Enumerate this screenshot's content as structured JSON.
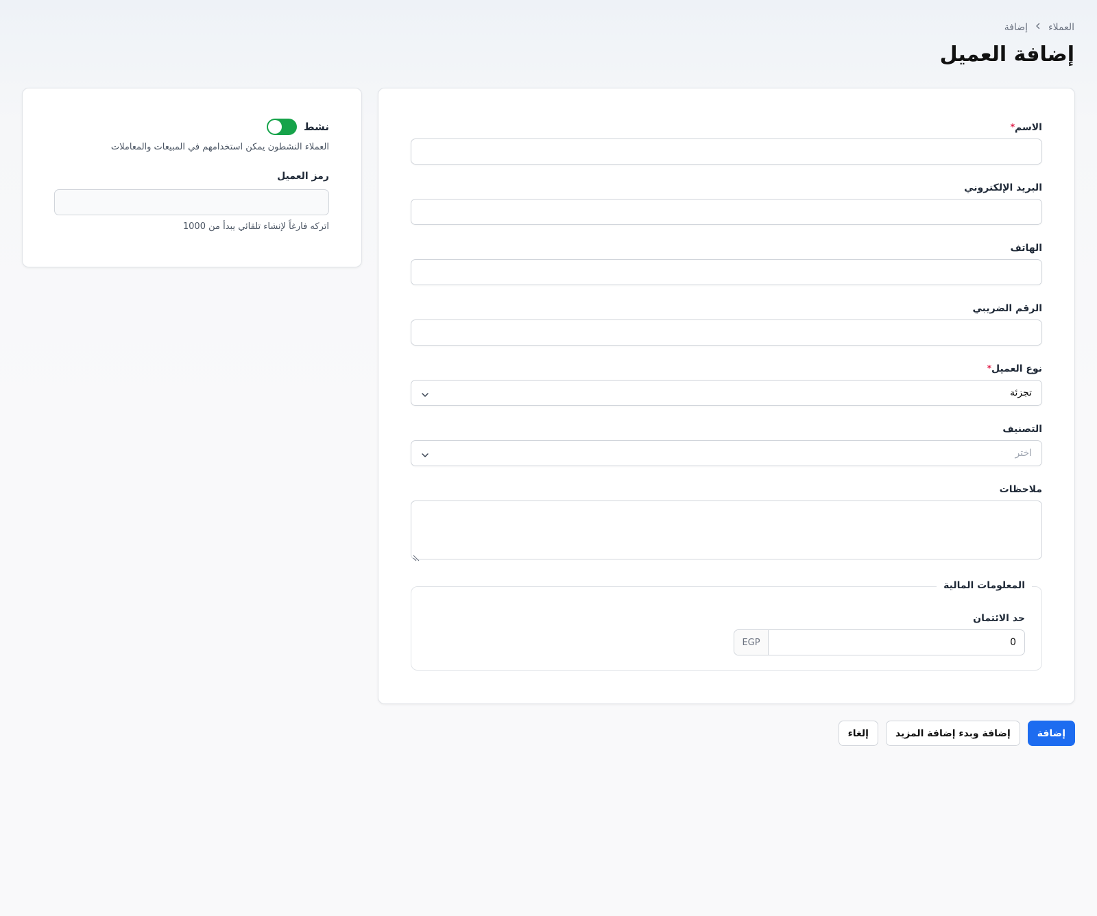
{
  "breadcrumb": {
    "parent": "العملاء",
    "current": "إضافة"
  },
  "page": {
    "title": "إضافة العميل"
  },
  "form": {
    "name": {
      "label": "الاسم",
      "required_mark": "*",
      "value": ""
    },
    "email": {
      "label": "البريد الإلكتروني",
      "value": ""
    },
    "phone": {
      "label": "الهاتف",
      "value": ""
    },
    "tax_number": {
      "label": "الرقم الضريبي",
      "value": ""
    },
    "customer_type": {
      "label": "نوع العميل",
      "required_mark": "*",
      "selected": "تجزئة"
    },
    "category": {
      "label": "التصنيف",
      "placeholder": "اختر"
    },
    "notes": {
      "label": "ملاحظات",
      "value": ""
    },
    "financial": {
      "legend": "المعلومات المالية",
      "credit_limit_label": "حد الائتمان",
      "credit_limit_value": "0",
      "currency": "EGP"
    }
  },
  "side": {
    "active_label": "نشط",
    "active_on": true,
    "active_help": "العملاء النشطون يمكن استخدامهم في المبيعات والمعاملات",
    "code_label": "رمز العميل",
    "code_value": "",
    "code_help": "اتركه فارغاً لإنشاء تلقائي يبدأ من 1000"
  },
  "actions": {
    "add": "إضافة",
    "add_and_more": "إضافة وبدء إضافة المزيد",
    "cancel": "إلغاء"
  },
  "colors": {
    "primary": "#1d6cf0",
    "toggle_on": "#16a34a",
    "required": "#e11d48"
  }
}
